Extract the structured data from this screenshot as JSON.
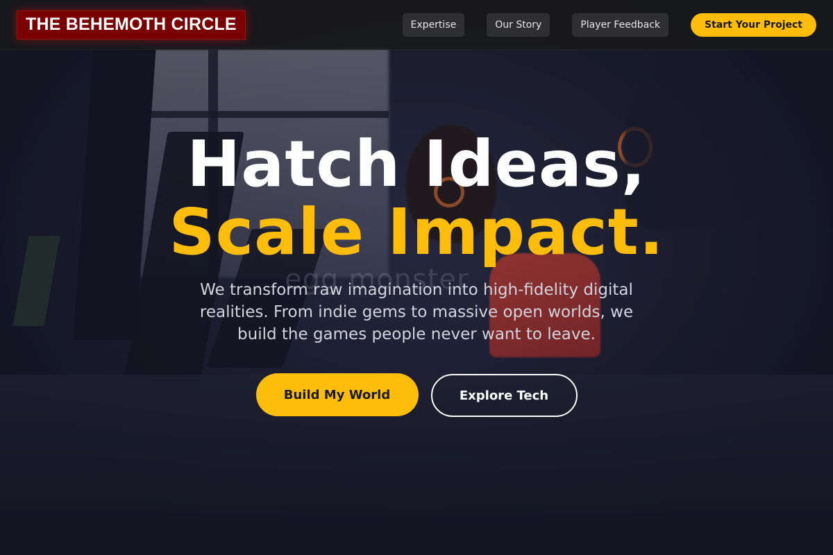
{
  "brand": {
    "name": "THE BEHEMOTH CIRCLE"
  },
  "nav": {
    "links": [
      "Expertise",
      "Our Story",
      "Player Feedback"
    ],
    "cta_label": "Start Your Project"
  },
  "hero": {
    "headline_line1": "Hatch Ideas,",
    "headline_line2": "Scale Impact.",
    "subtitle": "We transform raw imagination into high-fidelity digital realities. From indie gems to massive open worlds, we build the games people never want to leave.",
    "primary_cta": "Build My World",
    "secondary_cta": "Explore Tech",
    "background_watermark": "egg monster"
  },
  "colors": {
    "accent": "#fdbd0a",
    "brand_bg": "#7a0000",
    "nav_bg": "#18181a"
  }
}
